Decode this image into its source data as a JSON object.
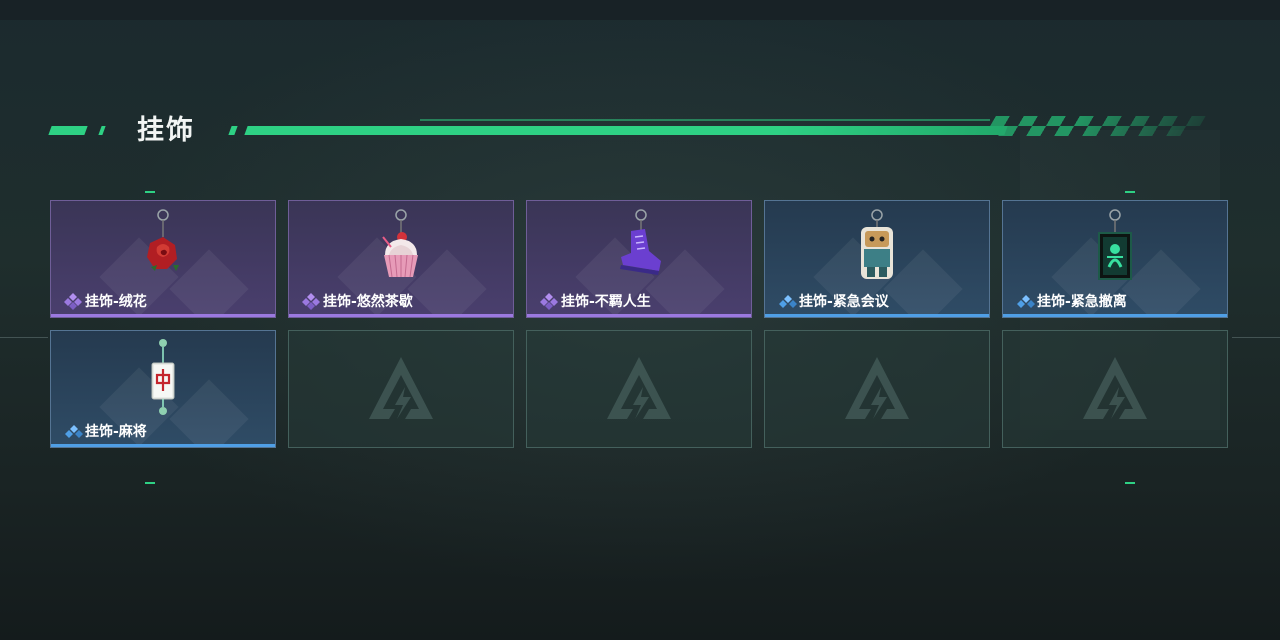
{
  "section": {
    "title": "挂饰"
  },
  "items": [
    {
      "label": "挂饰-绒花",
      "rarity": "epic",
      "icon": "rose-charm-icon"
    },
    {
      "label": "挂饰-悠然茶歇",
      "rarity": "epic",
      "icon": "cupcake-charm-icon"
    },
    {
      "label": "挂饰-不羁人生",
      "rarity": "epic",
      "icon": "sneaker-charm-icon"
    },
    {
      "label": "挂饰-紧急会议",
      "rarity": "rare",
      "icon": "robot-charm-icon"
    },
    {
      "label": "挂饰-紧急撤离",
      "rarity": "rare",
      "icon": "emergency-sign-charm-icon"
    },
    {
      "label": "挂饰-麻将",
      "rarity": "rare",
      "icon": "mahjong-tile-charm-icon"
    }
  ],
  "empty_slot_icon": "game-logo-icon",
  "colors": {
    "accent_green": "#2ed184",
    "epic_purple": "#9b79e0",
    "rare_blue": "#4f9fe6"
  }
}
